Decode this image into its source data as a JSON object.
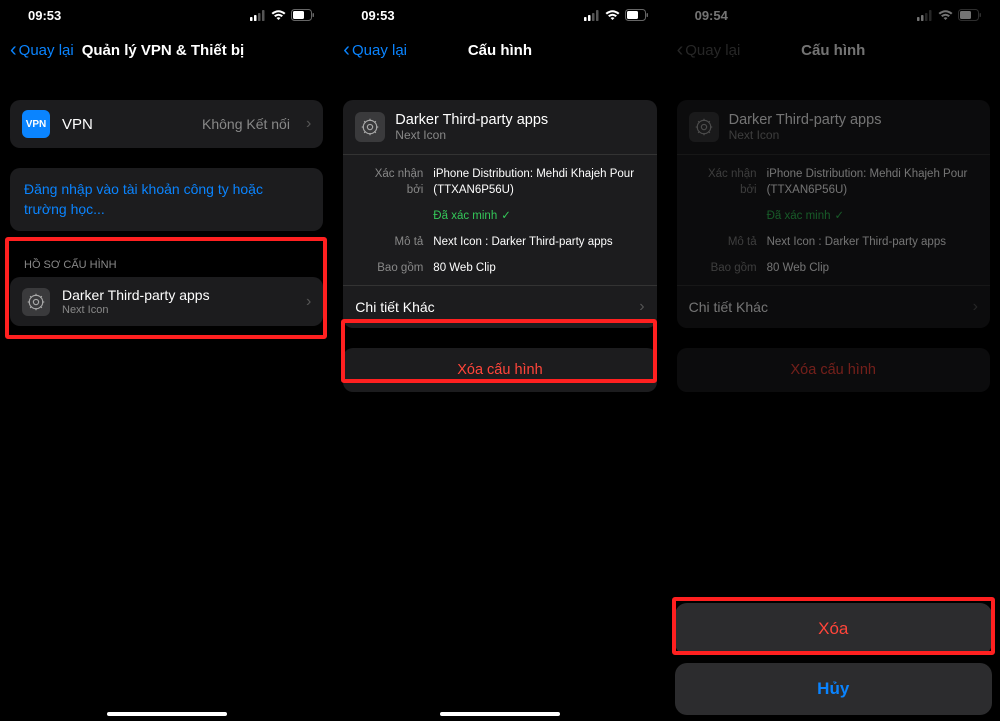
{
  "status": {
    "time1": "09:53",
    "time2": "09:53",
    "time3": "09:54"
  },
  "s1": {
    "back": "Quay lại",
    "title": "Quản lý VPN & Thiết bị",
    "vpn_icon": "VPN",
    "vpn_label": "VPN",
    "vpn_status": "Không Kết nối",
    "signin": "Đăng nhập vào tài khoản công ty hoặc trường học...",
    "section": "HỒ SƠ CẤU HÌNH",
    "profile_title": "Darker Third-party apps",
    "profile_sub": "Next Icon"
  },
  "s2": {
    "back": "Quay lại",
    "title": "Cấu hình",
    "profile_title": "Darker Third-party apps",
    "profile_sub": "Next Icon",
    "k_signed": "Xác nhận bởi",
    "v_signed": "iPhone Distribution: Mehdi Khajeh Pour (TTXAN6P56U)",
    "verified": "Đã xác minh",
    "k_desc": "Mô tả",
    "v_desc": "Next Icon : Darker Third-party apps",
    "k_contains": "Bao gồm",
    "v_contains": "80 Web Clip",
    "more": "Chi tiết Khác",
    "delete": "Xóa cấu hình"
  },
  "s3": {
    "back": "Quay lại",
    "title": "Cấu hình",
    "delete_action": "Xóa",
    "cancel_action": "Hủy"
  }
}
